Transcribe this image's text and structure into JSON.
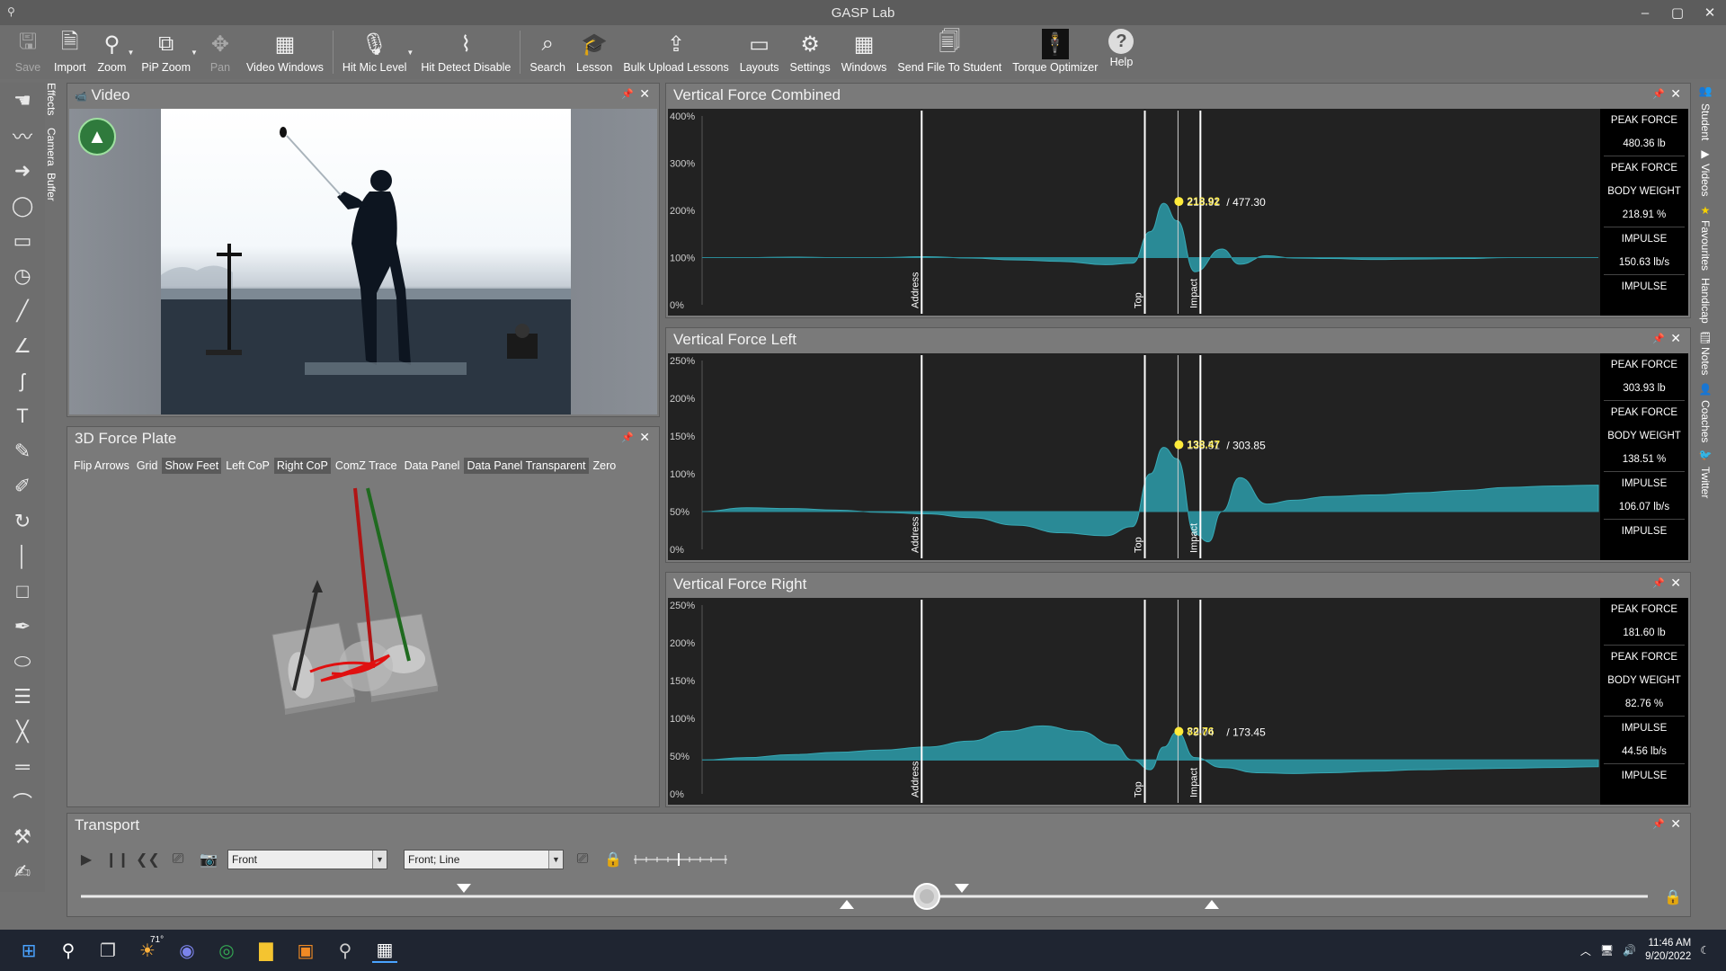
{
  "window": {
    "title": "GASP Lab"
  },
  "toolbar": {
    "save": "Save",
    "import": "Import",
    "zoom": "Zoom",
    "pip_zoom": "PiP Zoom",
    "pan": "Pan",
    "video_windows": "Video Windows",
    "hit_mic_level": "Hit Mic Level",
    "hit_detect_disable": "Hit Detect Disable",
    "search": "Search",
    "lesson": "Lesson",
    "bulk_upload": "Bulk Upload Lessons",
    "layouts": "Layouts",
    "settings": "Settings",
    "windows": "Windows",
    "send_file": "Send File To Student",
    "torque_optimizer": "Torque Optimizer",
    "help": "Help"
  },
  "left_tabs": [
    "Effects",
    "Camera",
    "Buffer"
  ],
  "right_tabs": [
    "Student",
    "Videos",
    "Favourites",
    "Handicap",
    "Notes",
    "Coaches",
    "Twitter"
  ],
  "video_panel": {
    "title": "Video"
  },
  "force_plate": {
    "title": "3D Force Plate",
    "buttons": [
      {
        "label": "Flip Arrows",
        "on": false
      },
      {
        "label": "Grid",
        "on": false
      },
      {
        "label": "Show Feet",
        "on": true
      },
      {
        "label": "Left CoP",
        "on": false
      },
      {
        "label": "Right CoP",
        "on": true
      },
      {
        "label": "ComZ Trace",
        "on": false
      },
      {
        "label": "Data Panel",
        "on": false
      },
      {
        "label": "Data Panel Transparent",
        "on": true
      },
      {
        "label": "Zero",
        "on": false
      }
    ]
  },
  "markers": {
    "address": "Address",
    "top": "Top",
    "impact": "Impact"
  },
  "stat_labels": {
    "peak_force": "PEAK FORCE",
    "body_weight": "BODY WEIGHT",
    "impulse": "IMPULSE"
  },
  "charts": {
    "combined": {
      "title": "Vertical Force Combined",
      "y_ticks": [
        "400%",
        "300%",
        "200%",
        "100%",
        "0%"
      ],
      "tooltip_a": "218.92",
      "tooltip_b": "218.91",
      "tooltip_total": "/ 477.30",
      "peak_force": "480.36 lb",
      "body_weight_pct": "218.91 %",
      "impulse": "150.63 lb/s"
    },
    "left": {
      "title": "Vertical Force Left",
      "y_ticks": [
        "250%",
        "200%",
        "150%",
        "100%",
        "50%",
        "0%"
      ],
      "tooltip_a": "138.47",
      "tooltip_b": "138.51",
      "tooltip_total": "/ 303.85",
      "peak_force": "303.93 lb",
      "body_weight_pct": "138.51 %",
      "impulse": "106.07 lb/s"
    },
    "right": {
      "title": "Vertical Force Right",
      "y_ticks": [
        "250%",
        "200%",
        "150%",
        "100%",
        "50%",
        "0%"
      ],
      "tooltip_a": "82.76",
      "tooltip_b": "79.04",
      "tooltip_total": "/ 173.45",
      "peak_force": "181.60 lb",
      "body_weight_pct": "82.76 %",
      "impulse": "44.56 lb/s"
    }
  },
  "chart_data": [
    {
      "type": "area",
      "title": "Vertical Force Combined",
      "ylabel": "",
      "ylim": [
        0,
        400
      ],
      "y_ticks": [
        0,
        100,
        200,
        300,
        400
      ],
      "x": [
        0,
        5,
        10,
        15,
        20,
        25,
        30,
        35,
        40,
        45,
        48,
        50,
        51.5,
        53,
        55,
        58,
        60,
        63,
        66,
        70,
        75,
        80,
        85,
        90,
        95,
        100
      ],
      "values": [
        100,
        100,
        101,
        100,
        100,
        102,
        99,
        95,
        92,
        85,
        88,
        155,
        215,
        178,
        70,
        118,
        86,
        104,
        99,
        98,
        96,
        97,
        98,
        100,
        100,
        100
      ],
      "markers": [
        {
          "label": "Address",
          "x": 24.5
        },
        {
          "label": "Top",
          "x": 49.4
        },
        {
          "label": "Impact",
          "x": 55.6
        }
      ],
      "peak": {
        "x": 55.3,
        "y": 218.91
      }
    },
    {
      "type": "area",
      "title": "Vertical Force Left",
      "ylabel": "",
      "ylim": [
        0,
        250
      ],
      "y_ticks": [
        0,
        50,
        100,
        150,
        200,
        250
      ],
      "x": [
        0,
        5,
        10,
        15,
        20,
        25,
        30,
        35,
        40,
        45,
        48,
        50,
        51.5,
        53,
        55,
        56.5,
        58,
        60,
        63,
        66,
        70,
        75,
        80,
        85,
        90,
        95,
        100
      ],
      "values": [
        50,
        55,
        54,
        52,
        49,
        47,
        42,
        32,
        22,
        18,
        30,
        100,
        135,
        120,
        20,
        10,
        50,
        95,
        60,
        65,
        70,
        72,
        75,
        78,
        82,
        84,
        85
      ],
      "markers": [
        {
          "label": "Address",
          "x": 24.5
        },
        {
          "label": "Top",
          "x": 49.4
        },
        {
          "label": "Impact",
          "x": 55.6
        }
      ],
      "peak": {
        "x": 55.3,
        "y": 138.51
      }
    },
    {
      "type": "area",
      "title": "Vertical Force Right",
      "ylabel": "",
      "ylim": [
        0,
        250
      ],
      "y_ticks": [
        0,
        50,
        100,
        150,
        200,
        250
      ],
      "x": [
        0,
        5,
        10,
        15,
        20,
        25,
        30,
        34,
        38,
        42,
        46,
        48,
        50,
        51.5,
        53,
        55,
        58,
        62,
        66,
        70,
        75,
        80,
        85,
        90,
        95,
        100
      ],
      "values": [
        45,
        48,
        52,
        55,
        58,
        62,
        70,
        83,
        90,
        83,
        65,
        45,
        32,
        62,
        82,
        48,
        35,
        28,
        27,
        28,
        30,
        32,
        33,
        34,
        35,
        36
      ],
      "markers": [
        {
          "label": "Address",
          "x": 24.5
        },
        {
          "label": "Top",
          "x": 49.4
        },
        {
          "label": "Impact",
          "x": 55.6
        }
      ],
      "peak": {
        "x": 55.3,
        "y": 82.76
      }
    }
  ],
  "transport": {
    "title": "Transport",
    "view_select": "Front",
    "mode_select": "Front; Line"
  },
  "taskbar": {
    "weather_temp": "71°",
    "time": "11:46 AM",
    "date": "9/20/2022"
  },
  "colors": {
    "area_fill": "#2a8a96",
    "peak_marker": "#ffeb3b",
    "chart_bg": "#222222",
    "panel_bg": "#7a7a7a"
  }
}
